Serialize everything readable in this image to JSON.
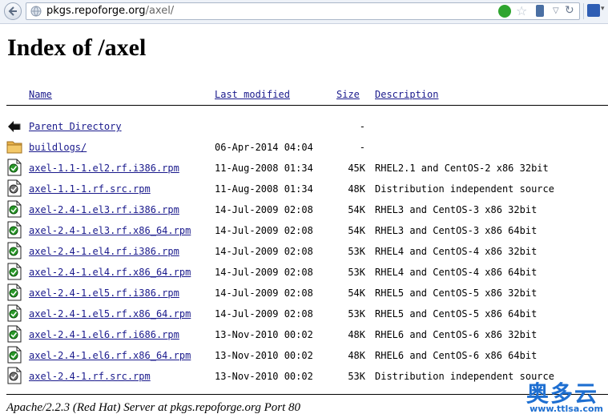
{
  "browser": {
    "url_host": "pkgs.repoforge.org",
    "url_path": "/axel/"
  },
  "page": {
    "title": "Index of /axel"
  },
  "table": {
    "headers": {
      "name": "Name",
      "modified": "Last modified",
      "size": "Size",
      "description": "Description"
    },
    "rows": [
      {
        "icon": "back-arrow-icon",
        "name": "Parent Directory",
        "modified": "",
        "size": "-",
        "description": ""
      },
      {
        "icon": "folder-icon",
        "name": " buildlogs/",
        "modified": "06-Apr-2014 04:04",
        "size": "-",
        "description": ""
      },
      {
        "icon": "binary-file-icon",
        "name": "axel-1.1-1.el2.rf.i386.rpm",
        "modified": "11-Aug-2008 01:34",
        "size": "45K",
        "description": "RHEL2.1 and CentOS-2 x86 32bit"
      },
      {
        "icon": "source-file-icon",
        "name": "axel-1.1-1.rf.src.rpm",
        "modified": "11-Aug-2008 01:34",
        "size": "48K",
        "description": "Distribution independent source"
      },
      {
        "icon": "binary-file-icon",
        "name": "axel-2.4-1.el3.rf.i386.rpm",
        "modified": "14-Jul-2009 02:08",
        "size": "54K",
        "description": "RHEL3 and CentOS-3 x86 32bit"
      },
      {
        "icon": "binary-file-icon",
        "name": "axel-2.4-1.el3.rf.x86_64.rpm",
        "modified": "14-Jul-2009 02:08",
        "size": "54K",
        "description": "RHEL3 and CentOS-3 x86 64bit"
      },
      {
        "icon": "binary-file-icon",
        "name": "axel-2.4-1.el4.rf.i386.rpm",
        "modified": "14-Jul-2009 02:08",
        "size": "53K",
        "description": "RHEL4 and CentOS-4 x86 32bit"
      },
      {
        "icon": "binary-file-icon",
        "name": "axel-2.4-1.el4.rf.x86_64.rpm",
        "modified": "14-Jul-2009 02:08",
        "size": "53K",
        "description": "RHEL4 and CentOS-4 x86 64bit"
      },
      {
        "icon": "binary-file-icon",
        "name": "axel-2.4-1.el5.rf.i386.rpm",
        "modified": "14-Jul-2009 02:08",
        "size": "54K",
        "description": "RHEL5 and CentOS-5 x86 32bit"
      },
      {
        "icon": "binary-file-icon",
        "name": "axel-2.4-1.el5.rf.x86_64.rpm",
        "modified": "14-Jul-2009 02:08",
        "size": "53K",
        "description": "RHEL5 and CentOS-5 x86 64bit"
      },
      {
        "icon": "binary-file-icon",
        "name": "axel-2.4-1.el6.rf.i686.rpm",
        "modified": "13-Nov-2010 00:02",
        "size": "48K",
        "description": "RHEL6 and CentOS-6 x86 32bit"
      },
      {
        "icon": "binary-file-icon",
        "name": "axel-2.4-1.el6.rf.x86_64.rpm",
        "modified": "13-Nov-2010 00:02",
        "size": "48K",
        "description": "RHEL6 and CentOS-6 x86 64bit"
      },
      {
        "icon": "source-file-icon",
        "name": "axel-2.4-1.rf.src.rpm",
        "modified": "13-Nov-2010 00:02",
        "size": "53K",
        "description": "Distribution independent source"
      }
    ]
  },
  "footer": {
    "text": "Apache/2.2.3 (Red Hat) Server at pkgs.repoforge.org Port 80"
  },
  "watermark": {
    "text": "奥多云",
    "url": "www.ttlsa.com"
  }
}
